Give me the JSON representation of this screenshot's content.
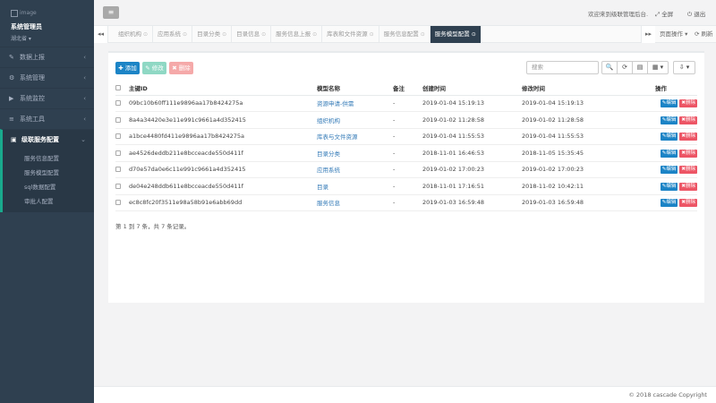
{
  "profile": {
    "image_alt": "image",
    "name": "系统管理员",
    "region": "湖北省 ▾"
  },
  "sidebar": {
    "items": [
      {
        "icon": "✎",
        "label": "数据上报"
      },
      {
        "icon": "⚙",
        "label": "系统管理"
      },
      {
        "icon": "▶",
        "label": "系统监控"
      },
      {
        "icon": "≡",
        "label": "系统工具"
      },
      {
        "icon": "▣",
        "label": "级联服务配置"
      }
    ],
    "submenu": [
      "服务信息配置",
      "服务模型配置",
      "sql数据配置",
      "审批人配置"
    ]
  },
  "header": {
    "menu_icon": "≡",
    "welcome": "欢迎来到级联管理后台.",
    "fullscreen": "⤢ 全屏",
    "logout": "⏻ 退出"
  },
  "tabs": {
    "left_nav": "◂◂",
    "right_nav": "▸▸",
    "items": [
      "组织机构",
      "应用系统",
      "目录分类",
      "目录信息",
      "服务信息上报",
      "库表和文件资源",
      "服务信息配置",
      "服务模型配置"
    ],
    "close_icon": "⊙",
    "page_ops": "页面操作 ▾",
    "refresh": "⟳ 刷新"
  },
  "toolbar": {
    "add": "✚ 添加",
    "edit": "✎ 修改",
    "delete": "✖ 删除",
    "search_placeholder": "搜索",
    "icons": [
      "🔍",
      "⟳",
      "▤",
      "▦ ▾",
      "⇩ ▾"
    ]
  },
  "table": {
    "headers": [
      "主键ID",
      "模型名称",
      "备注",
      "创建时间",
      "修改时间",
      "操作"
    ],
    "rows": [
      {
        "id": "09bc10b60ff111e9896aa17b8424275a",
        "name": "资源申请-供需",
        "remark": "-",
        "created": "2019-01-04 15:19:13",
        "modified": "2019-01-04 15:19:13"
      },
      {
        "id": "8a4a34420e3e11e991c9661a4d352415",
        "name": "组织机构",
        "remark": "-",
        "created": "2019-01-02 11:28:58",
        "modified": "2019-01-02 11:28:58"
      },
      {
        "id": "a1bce4480fd411e9896aa17b8424275a",
        "name": "库表与文件资源",
        "remark": "-",
        "created": "2019-01-04 11:55:53",
        "modified": "2019-01-04 11:55:53"
      },
      {
        "id": "ae4526deddb211e8bcceacde550d411f",
        "name": "目录分类",
        "remark": "-",
        "created": "2018-11-01 16:46:53",
        "modified": "2018-11-05 15:35:45"
      },
      {
        "id": "d70e57da0e6c11e991c9661a4d352415",
        "name": "应用系统",
        "remark": "-",
        "created": "2019-01-02 17:00:23",
        "modified": "2019-01-02 17:00:23"
      },
      {
        "id": "de04e248ddb611e8bcceacde550d411f",
        "name": "目录",
        "remark": "-",
        "created": "2018-11-01 17:16:51",
        "modified": "2018-11-02 10:42:11"
      },
      {
        "id": "ec8c8fc20f3511e98a58b91e6abb69dd",
        "name": "服务信息",
        "remark": "-",
        "created": "2019-01-03 16:59:48",
        "modified": "2019-01-03 16:59:48"
      }
    ],
    "row_edit": "✎编辑",
    "row_delete": "✖删除"
  },
  "pager": {
    "info": "第 1 到 7 条，共 7 条记录。"
  },
  "footer": {
    "copyright": "© 2018 cascade Copyright"
  },
  "colors": {
    "sidebar": "#2f4050",
    "accent": "#19aa8d",
    "primary": "#1c84c6",
    "danger": "#ed5565"
  }
}
